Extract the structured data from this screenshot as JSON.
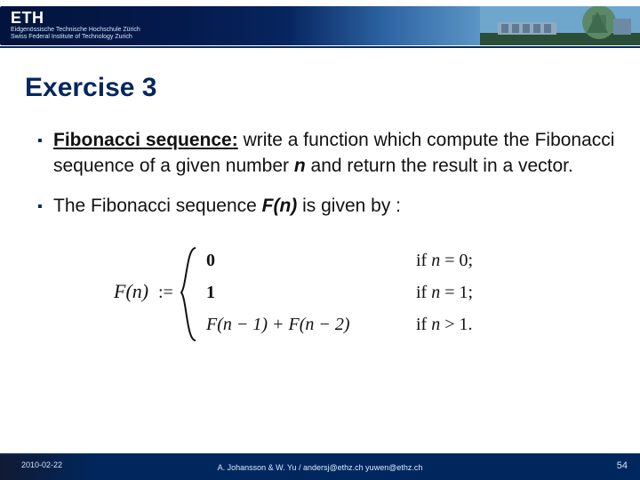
{
  "header": {
    "logo_text": "ETH",
    "subtext_line1": "Eidgenössische Technische Hochschule Zürich",
    "subtext_line2": "Swiss Federal Institute of Technology Zurich"
  },
  "title": "Exercise 3",
  "bullets": {
    "b1_strong": "Fibonacci sequence:",
    "b1_rest_a": " write a function which compute the Fibonacci sequence of a given number ",
    "b1_n": "n",
    "b1_rest_b": " and return the result in a vector.",
    "b2_a": "The Fibonacci sequence ",
    "b2_fn": "F(n)",
    "b2_b": "  is given by :"
  },
  "formula": {
    "lhs": "F(n) :=",
    "row1_val": "0",
    "row1_cond": "if n = 0;",
    "row2_val": "1",
    "row2_cond": "if n = 1;",
    "row3_val": "F(n − 1) + F(n − 2)",
    "row3_cond": "if n > 1."
  },
  "footer": {
    "date": "2010-02-22",
    "authors": "A. Johansson & W. Yu /  andersj@ethz.ch  yuwen@ethz.ch",
    "page": "54"
  }
}
